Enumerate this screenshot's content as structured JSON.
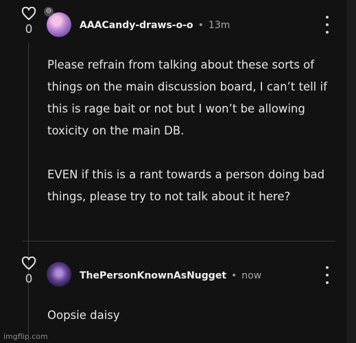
{
  "comments": [
    {
      "votes": "0",
      "username": "AAACandy-draws-o-o",
      "time": "13m",
      "badge": "⚙",
      "paragraph1": "Please refrain from talking about these sorts of things on the main discussion board, I can’t tell if this is rage bait or not but I won’t be allowing toxicity on the main DB.",
      "paragraph2": "EVEN if this is a rant towards a  person doing bad things, please try to not talk about it here?"
    },
    {
      "votes": "0",
      "username": "ThePersonKnownAsNugget",
      "time": "now",
      "paragraph1": "Oopsie daisy"
    }
  ],
  "separator": "•",
  "watermark": "imgflip.com",
  "icons": {
    "vote": "heart-outline-icon",
    "menu": "vertical-ellipsis-icon",
    "badge": "gear-icon"
  },
  "colors": {
    "background": "#121212",
    "text": "#e8e8e8",
    "muted": "#a8a8a8"
  }
}
